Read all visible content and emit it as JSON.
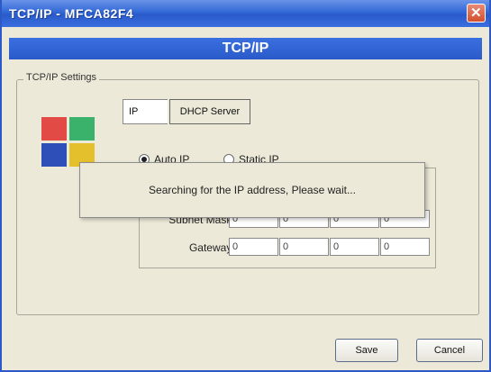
{
  "window": {
    "title": "TCP/IP - MFCA82F4",
    "close_glyph": "✕",
    "title_bar_color": "#2a5ac9"
  },
  "banner": {
    "title": "TCP/IP"
  },
  "group": {
    "legend": "TCP/IP Settings"
  },
  "tabs": {
    "ip": "IP",
    "dhcp": "DHCP Server"
  },
  "mode": {
    "auto_label": "Auto IP",
    "static_label": "Static IP",
    "selected": "Auto IP"
  },
  "fields": {
    "subnet": {
      "label": "Subnet Mask :",
      "octets": [
        "0",
        "0",
        "0",
        "0"
      ]
    },
    "gateway": {
      "label": "Gateway :",
      "octets": [
        "0",
        "0",
        "0",
        "0"
      ]
    }
  },
  "buttons": {
    "save": "Save",
    "cancel": "Cancel"
  },
  "popup": {
    "message": "Searching for the IP address, Please wait..."
  }
}
